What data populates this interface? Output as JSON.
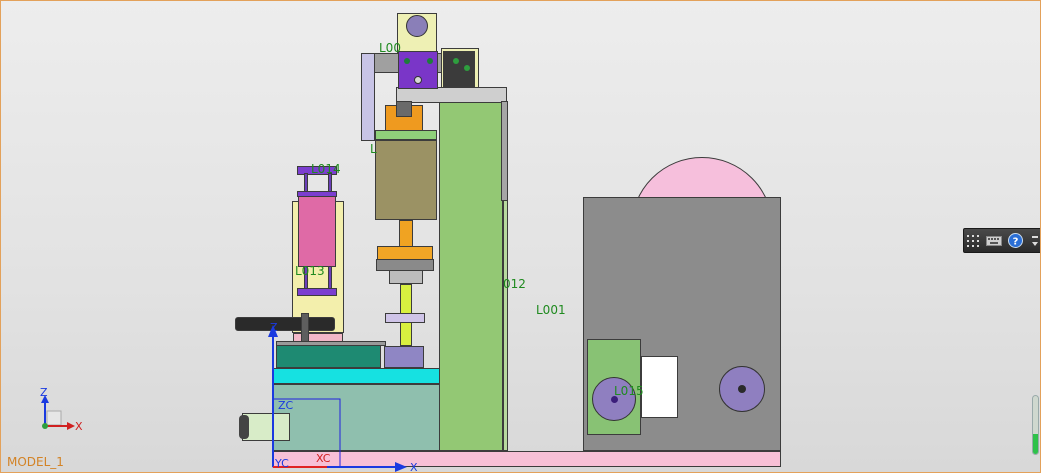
{
  "model": {
    "name": "MODEL_1"
  },
  "labels": {
    "l00": "L00",
    "l014": "L014",
    "l013": "L013",
    "l012": "012",
    "l001": "L001",
    "l015": "L015",
    "l_small": "L"
  },
  "triad": {
    "z": "Z",
    "x": "X"
  },
  "csys": {
    "z": "Z",
    "zc": "ZC",
    "x": "X",
    "xc": "XC",
    "yc": "YC"
  },
  "toolbar": {
    "icons": [
      "grid-icon",
      "keyboard-icon",
      "help-icon",
      "collapse-icon"
    ]
  },
  "scroll": {
    "fraction": 0.35
  },
  "colors": {
    "frame": "#e3a15a",
    "label": "#1f8a1f",
    "model_name": "#d38326"
  }
}
